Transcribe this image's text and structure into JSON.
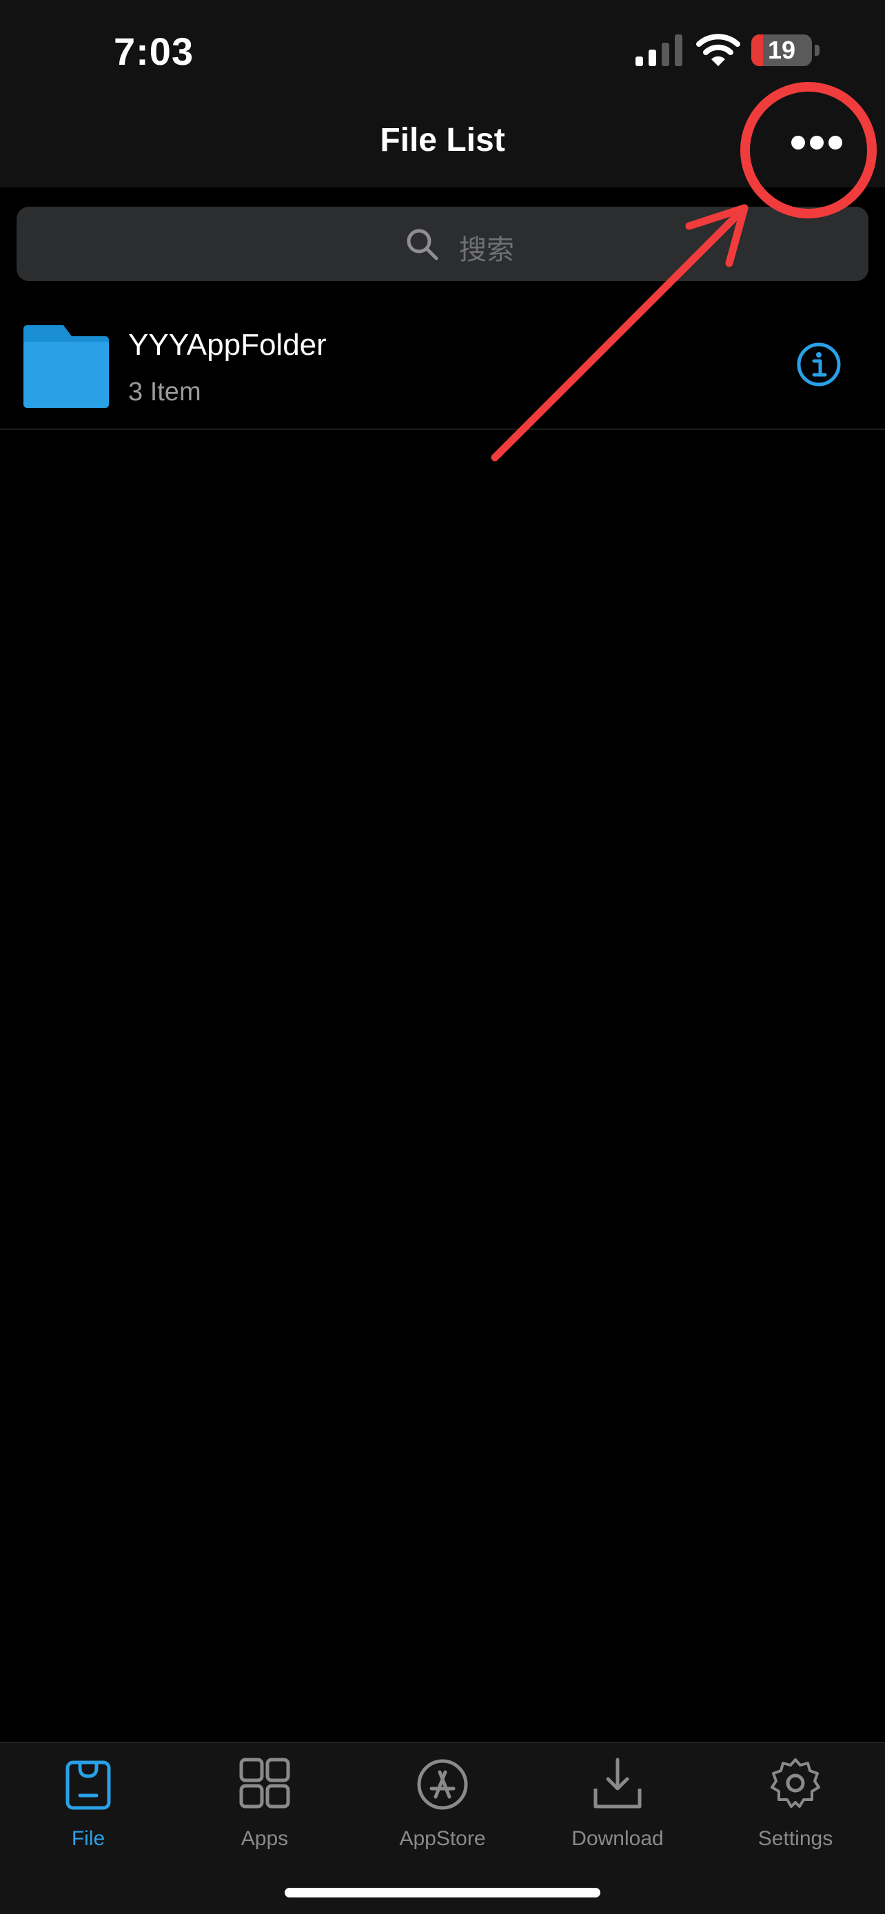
{
  "status_bar": {
    "time": "7:03",
    "battery_level": "19",
    "battery_fraction": 0.19
  },
  "nav": {
    "title": "File List",
    "more_icon": "ellipsis-icon"
  },
  "search": {
    "placeholder": "搜索"
  },
  "file_list": [
    {
      "name": "YYYAppFolder",
      "subtitle": "3 Item",
      "icon": "folder-icon",
      "accessory": "info-icon"
    }
  ],
  "tab_bar": {
    "items": [
      {
        "label": "File",
        "icon": "file-bag-icon",
        "active": true
      },
      {
        "label": "Apps",
        "icon": "apps-grid-icon",
        "active": false
      },
      {
        "label": "AppStore",
        "icon": "appstore-icon",
        "active": false
      },
      {
        "label": "Download",
        "icon": "download-icon",
        "active": false
      },
      {
        "label": "Settings",
        "icon": "gear-icon",
        "active": false
      }
    ]
  },
  "colors": {
    "accent": "#2aa1e6",
    "folder": "#1e9be0",
    "annotation": "#f03c3c",
    "battery_low": "#e53935"
  }
}
